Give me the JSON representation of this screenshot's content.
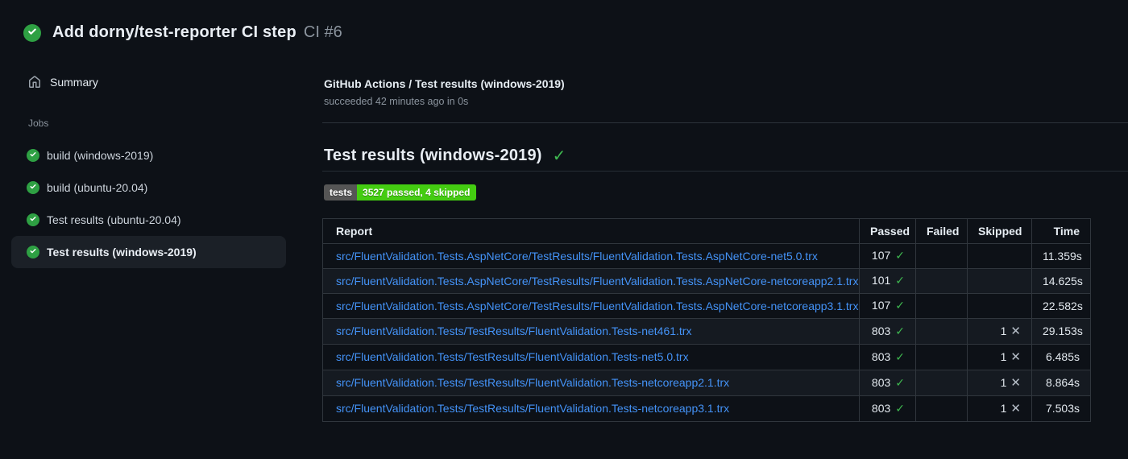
{
  "colors": {
    "page_background": "#0d1117",
    "success_green": "#3fb950",
    "status_circle_green": "#2ea043",
    "link_blue": "#4493f8",
    "badge_label_gray": "#555555",
    "badge_value_green": "#44cc11",
    "table_border": "#30363d",
    "row_alt_background": "#151a21",
    "selected_item_background": "#1b2027"
  },
  "icons": {
    "check_mark": "✓",
    "cross_mark": "✕"
  },
  "header": {
    "status": "success",
    "title": "Add dorny/test-reporter CI step",
    "run_number": "CI #6"
  },
  "sidebar": {
    "summary_label": "Summary",
    "jobs_label": "Jobs",
    "jobs": [
      {
        "name": "build (windows-2019)",
        "status": "success",
        "selected": false
      },
      {
        "name": "build (ubuntu-20.04)",
        "status": "success",
        "selected": false
      },
      {
        "name": "Test results (ubuntu-20.04)",
        "status": "success",
        "selected": false
      },
      {
        "name": "Test results (windows-2019)",
        "status": "success",
        "selected": true
      }
    ]
  },
  "main": {
    "breadcrumb": "GitHub Actions / Test results (windows-2019)",
    "status_line": "succeeded 42 minutes ago in 0s",
    "heading": "Test results (windows-2019)",
    "heading_status": "success",
    "badge": {
      "label": "tests",
      "value": "3527 passed, 4 skipped"
    },
    "table": {
      "headers": [
        "Report",
        "Passed",
        "Failed",
        "Skipped",
        "Time"
      ],
      "rows": [
        {
          "report": "src/FluentValidation.Tests.AspNetCore/TestResults/FluentValidation.Tests.AspNetCore-net5.0.trx",
          "passed": "107",
          "failed": "",
          "skipped": "",
          "time": "11.359s"
        },
        {
          "report": "src/FluentValidation.Tests.AspNetCore/TestResults/FluentValidation.Tests.AspNetCore-netcoreapp2.1.trx",
          "passed": "101",
          "failed": "",
          "skipped": "",
          "time": "14.625s"
        },
        {
          "report": "src/FluentValidation.Tests.AspNetCore/TestResults/FluentValidation.Tests.AspNetCore-netcoreapp3.1.trx",
          "passed": "107",
          "failed": "",
          "skipped": "",
          "time": "22.582s"
        },
        {
          "report": "src/FluentValidation.Tests/TestResults/FluentValidation.Tests-net461.trx",
          "passed": "803",
          "failed": "",
          "skipped": "1",
          "time": "29.153s"
        },
        {
          "report": "src/FluentValidation.Tests/TestResults/FluentValidation.Tests-net5.0.trx",
          "passed": "803",
          "failed": "",
          "skipped": "1",
          "time": "6.485s"
        },
        {
          "report": "src/FluentValidation.Tests/TestResults/FluentValidation.Tests-netcoreapp2.1.trx",
          "passed": "803",
          "failed": "",
          "skipped": "1",
          "time": "8.864s"
        },
        {
          "report": "src/FluentValidation.Tests/TestResults/FluentValidation.Tests-netcoreapp3.1.trx",
          "passed": "803",
          "failed": "",
          "skipped": "1",
          "time": "7.503s"
        }
      ]
    }
  }
}
